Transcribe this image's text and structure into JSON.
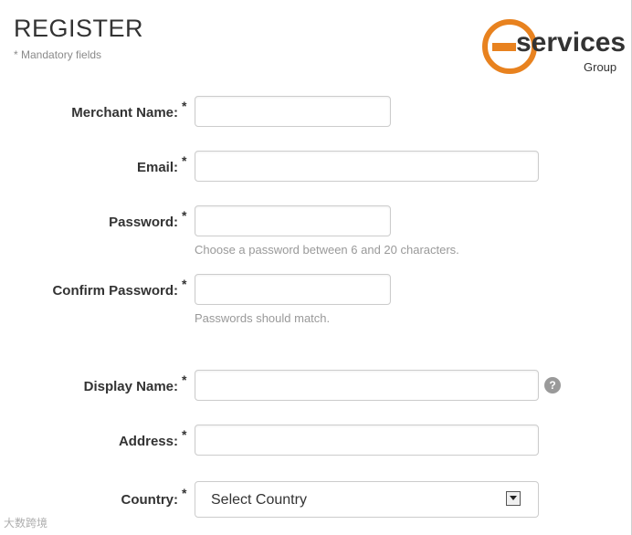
{
  "header": {
    "title": "REGISTER",
    "subtitle": "* Mandatory fields"
  },
  "logo": {
    "word": "services",
    "sub": "Group",
    "color": "#e8821f"
  },
  "form": {
    "required_mark": "*",
    "merchant_name": {
      "label": "Merchant Name:",
      "value": ""
    },
    "email": {
      "label": "Email:",
      "value": ""
    },
    "password": {
      "label": "Password:",
      "value": "",
      "hint": "Choose a password between 6 and 20 characters."
    },
    "confirm_password": {
      "label": "Confirm Password:",
      "value": "",
      "hint": "Passwords should match."
    },
    "display_name": {
      "label": "Display Name:",
      "value": "",
      "help_icon": "help-icon"
    },
    "address": {
      "label": "Address:",
      "value": ""
    },
    "country": {
      "label": "Country:",
      "selected": "Select Country"
    }
  },
  "watermark": {
    "text": "大数跨境"
  }
}
